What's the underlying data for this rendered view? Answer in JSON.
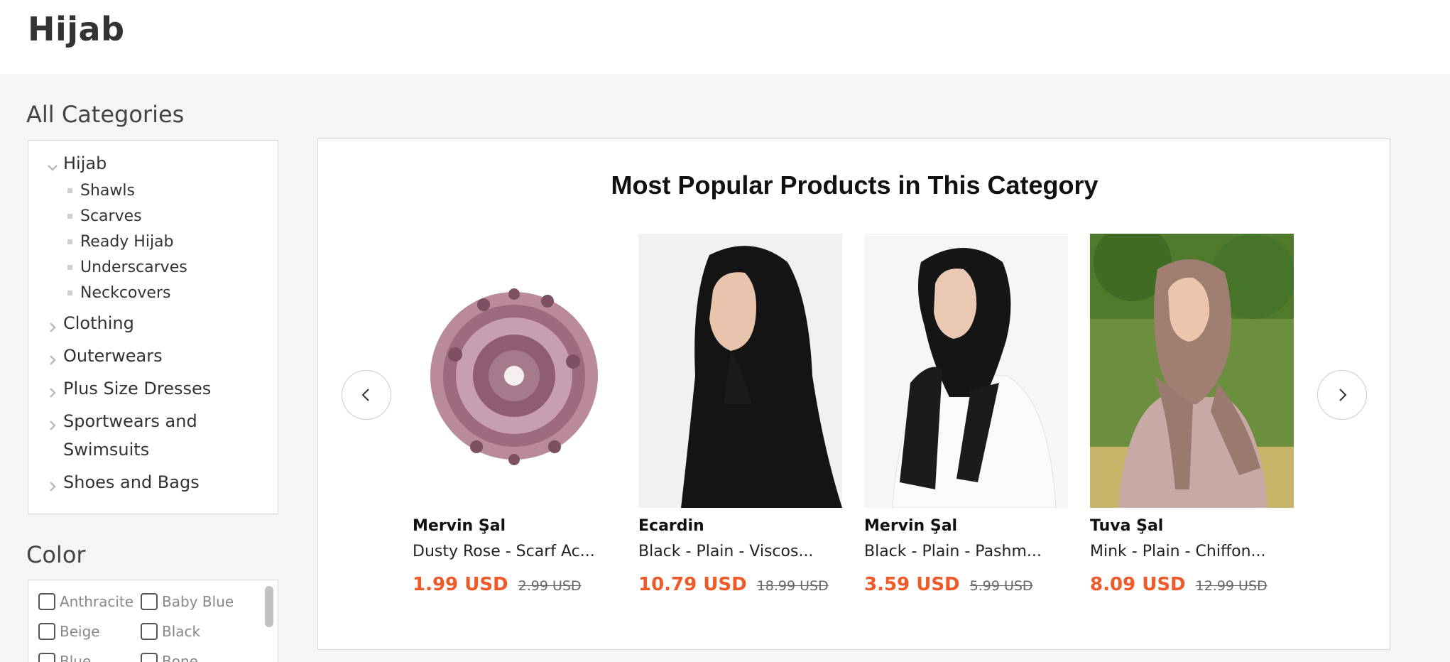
{
  "page": {
    "title": "Hijab"
  },
  "sidebar": {
    "categories_title": "All Categories",
    "categories": [
      {
        "label": "Hijab",
        "expanded": true,
        "children": [
          "Shawls",
          "Scarves",
          "Ready Hijab",
          "Underscarves",
          "Neckcovers"
        ]
      },
      {
        "label": "Clothing"
      },
      {
        "label": "Outerwears"
      },
      {
        "label": "Plus Size Dresses"
      },
      {
        "label": "Sportwears and",
        "label_line2": "Swimsuits"
      },
      {
        "label": "Shoes and Bags"
      }
    ],
    "color_title": "Color",
    "colors": [
      "Anthracite",
      "Baby Blue",
      "Beige",
      "Black",
      "Blue",
      "Bone"
    ]
  },
  "popular": {
    "title": "Most Popular Products in This Category",
    "products": [
      {
        "brand": "Mervin Şal",
        "name": "Dusty Rose - Scarf Ac...",
        "price": "1.99 USD",
        "old_price": "2.99 USD",
        "image": "scrunchie"
      },
      {
        "brand": "Ecardin",
        "name": "Black - Plain - Viscos...",
        "price": "10.79 USD",
        "old_price": "18.99 USD",
        "image": "black-hijab"
      },
      {
        "brand": "Mervin Şal",
        "name": "Black - Plain - Pashm...",
        "price": "3.59 USD",
        "old_price": "5.99 USD",
        "image": "black-shawl"
      },
      {
        "brand": "Tuva Şal",
        "name": "Mink - Plain - Chiffon...",
        "price": "8.09 USD",
        "old_price": "12.99 USD",
        "image": "mink-chiffon"
      }
    ],
    "prev_icon": "chevron-left-icon",
    "next_icon": "chevron-right-icon"
  },
  "colors": {
    "price": "#f05a28",
    "border": "#d5d5d5"
  }
}
